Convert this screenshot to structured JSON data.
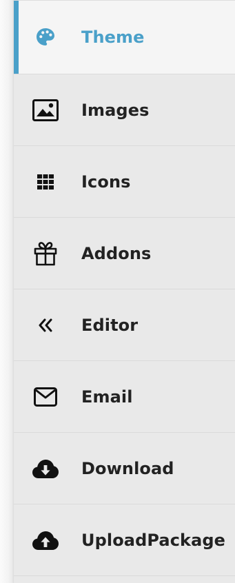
{
  "sidebar": {
    "active_color": "#4aa0c9",
    "items": [
      {
        "id": "theme",
        "label": "Theme",
        "icon": "palette-icon",
        "active": true
      },
      {
        "id": "images",
        "label": "Images",
        "icon": "image-icon",
        "active": false
      },
      {
        "id": "icons",
        "label": "Icons",
        "icon": "grid-icon",
        "active": false
      },
      {
        "id": "addons",
        "label": "Addons",
        "icon": "gift-icon",
        "active": false
      },
      {
        "id": "editor",
        "label": "Editor",
        "icon": "double-chevron-left-icon",
        "active": false
      },
      {
        "id": "email",
        "label": "Email",
        "icon": "envelope-icon",
        "active": false
      },
      {
        "id": "download",
        "label": "Download",
        "icon": "cloud-download-icon",
        "active": false
      },
      {
        "id": "uploadpackage",
        "label": "UploadPackage",
        "icon": "cloud-upload-icon",
        "active": false
      }
    ]
  }
}
